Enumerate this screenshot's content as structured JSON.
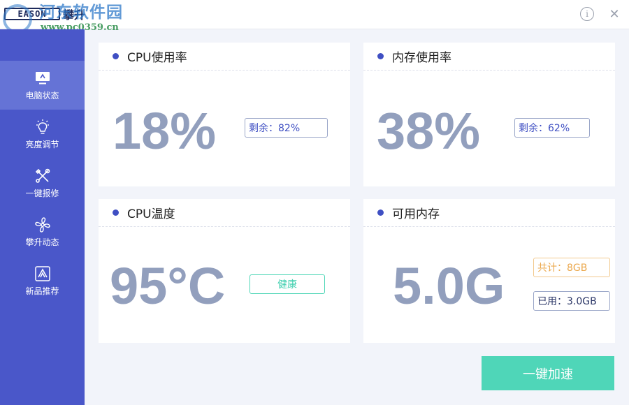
{
  "app": {
    "logo_text": "EASON",
    "name": "攀升"
  },
  "watermark": {
    "title": "河东软件园",
    "url": "www.pc0359.cn"
  },
  "window": {
    "info_icon": "info-icon",
    "close_icon": "close-icon"
  },
  "sidebar": {
    "items": [
      {
        "label": "电脑状态",
        "icon": "monitor-icon",
        "active": true
      },
      {
        "label": "亮度调节",
        "icon": "lightbulb-icon",
        "active": false
      },
      {
        "label": "一键报修",
        "icon": "tools-icon",
        "active": false
      },
      {
        "label": "攀升动态",
        "icon": "fan-icon",
        "active": false
      },
      {
        "label": "新品推荐",
        "icon": "recommend-icon",
        "active": false
      }
    ]
  },
  "cards": {
    "cpu_usage": {
      "title": "CPU使用率",
      "value": "18%",
      "tag": "剩余：82%"
    },
    "mem_usage": {
      "title": "内存使用率",
      "value": "38%",
      "tag": "剩余：62%"
    },
    "cpu_temp": {
      "title": "CPU温度",
      "value": "95°C",
      "tag": "健康"
    },
    "mem_avail": {
      "title": "可用内存",
      "value": "5.0G",
      "total": "共计：8GB",
      "used": "已用：3.0GB"
    }
  },
  "actions": {
    "boost_label": "一键加速"
  },
  "colors": {
    "sidebar": "#4a57c9",
    "accent": "#3f4fc3",
    "value": "#929fbd",
    "green": "#4fd6b8",
    "orange": "#eba84d"
  }
}
